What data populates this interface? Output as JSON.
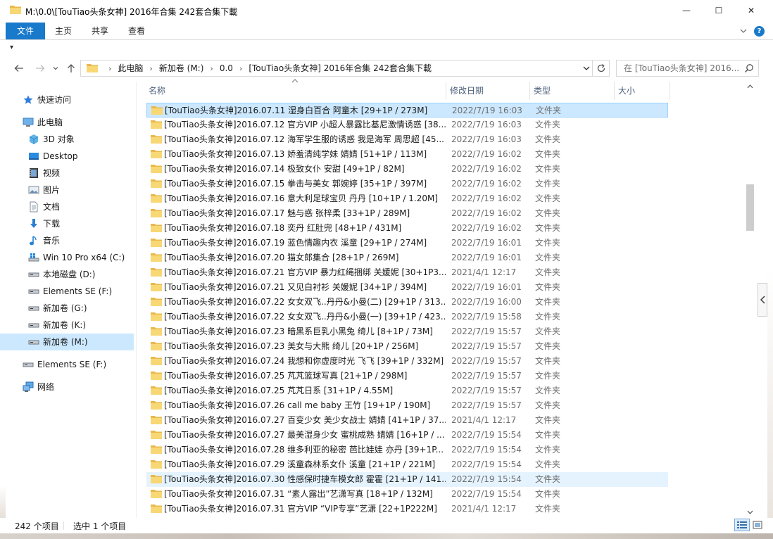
{
  "window": {
    "title": "M:\\0.0\\[TouTiao头条女神] 2016年合集 242套合集下載",
    "min_glyph": "—",
    "max_glyph": "☐",
    "close_glyph": "✕"
  },
  "ribbon": {
    "tabs": [
      "文件",
      "主页",
      "共享",
      "查看"
    ],
    "help_label": "?"
  },
  "qat": {
    "glyph": "▾"
  },
  "address": {
    "crumbs": [
      "此电脑",
      "新加卷 (M:)",
      "0.0",
      "[TouTiao头条女神] 2016年合集 242套合集下載"
    ],
    "separator": "›"
  },
  "search": {
    "placeholder": "在 [TouTiao头条女神] 2016..."
  },
  "navpane": {
    "items": [
      {
        "label": "快速访问",
        "icon": "star-icon"
      },
      {
        "label": "此电脑",
        "icon": "pc-icon"
      },
      {
        "label": "3D 对象",
        "icon": "cube-icon"
      },
      {
        "label": "Desktop",
        "icon": "desktop-icon"
      },
      {
        "label": "视频",
        "icon": "video-icon"
      },
      {
        "label": "图片",
        "icon": "picture-icon"
      },
      {
        "label": "文档",
        "icon": "document-icon"
      },
      {
        "label": "下载",
        "icon": "download-icon"
      },
      {
        "label": "音乐",
        "icon": "music-icon"
      },
      {
        "label": "Win 10 Pro x64 (C:)",
        "icon": "windows-drive-icon"
      },
      {
        "label": "本地磁盘 (D:)",
        "icon": "drive-icon"
      },
      {
        "label": "Elements SE (F:)",
        "icon": "drive-icon"
      },
      {
        "label": "新加卷 (G:)",
        "icon": "drive-icon"
      },
      {
        "label": "新加卷 (K:)",
        "icon": "drive-icon"
      },
      {
        "label": "新加卷 (M:)",
        "icon": "drive-icon"
      },
      {
        "label": "Elements SE (F:)",
        "icon": "drive-icon"
      },
      {
        "label": "网络",
        "icon": "network-icon"
      }
    ]
  },
  "columns": {
    "name": "名称",
    "date": "修改日期",
    "type": "类型",
    "size": "大小"
  },
  "files": [
    {
      "name": "[TouTiao头条女神]2016.07.11 湿身白百合 阿童木 [29+1P / 273M]",
      "date": "2022/7/19 16:03",
      "type": "文件夹"
    },
    {
      "name": "[TouTiao头条女神]2016.07.12 官方VIP 小超人暴露比基尼激情诱惑 [38...",
      "date": "2022/7/19 16:03",
      "type": "文件夹"
    },
    {
      "name": "[TouTiao头条女神]2016.07.12 海军学生服的诱惑 我是海军 周思超 [45...",
      "date": "2022/7/19 16:03",
      "type": "文件夹"
    },
    {
      "name": "[TouTiao头条女神]2016.07.13 娇羞清纯学妹 婧婧 [51+1P / 113M]",
      "date": "2022/7/19 16:02",
      "type": "文件夹"
    },
    {
      "name": "[TouTiao头条女神]2016.07.14 极致女仆 安甜 [49+1P / 82M]",
      "date": "2022/7/19 16:02",
      "type": "文件夹"
    },
    {
      "name": "[TouTiao头条女神]2016.07.15 拳击与美女 郭婉婷 [35+1P / 397M]",
      "date": "2022/7/19 16:02",
      "type": "文件夹"
    },
    {
      "name": "[TouTiao头条女神]2016.07.16 意大利足球宝贝 丹丹 [10+1P / 1.20M]",
      "date": "2022/7/19 16:02",
      "type": "文件夹"
    },
    {
      "name": "[TouTiao头条女神]2016.07.17 魅与惑 张梓柔 [33+1P / 289M]",
      "date": "2022/7/19 16:02",
      "type": "文件夹"
    },
    {
      "name": "[TouTiao头条女神]2016.07.18 奕丹 红肚兜 [48+1P / 431M]",
      "date": "2022/7/19 16:02",
      "type": "文件夹"
    },
    {
      "name": "[TouTiao头条女神]2016.07.19 蓝色情趣内衣 溪童 [29+1P / 274M]",
      "date": "2022/7/19 16:01",
      "type": "文件夹"
    },
    {
      "name": "[TouTiao头条女神]2016.07.20 猫女郎集合 [28+1P / 269M]",
      "date": "2022/7/19 16:01",
      "type": "文件夹"
    },
    {
      "name": "[TouTiao头条女神]2016.07.21 官方VIP  暴力红绳捆绑 关媛妮 [30+1P3...",
      "date": "2021/4/1 12:17",
      "type": "文件夹"
    },
    {
      "name": "[TouTiao头条女神]2016.07.21 又见白衬衫 关媛妮 [34+1P / 394M]",
      "date": "2022/7/19 16:01",
      "type": "文件夹"
    },
    {
      "name": "[TouTiao头条女神]2016.07.22 女女双飞..丹丹&小曼(二) [29+1P / 313...",
      "date": "2022/7/19 16:00",
      "type": "文件夹"
    },
    {
      "name": "[TouTiao头条女神]2016.07.22 女女双飞..丹丹&小曼(一) [39+1P / 423...",
      "date": "2022/7/19 15:58",
      "type": "文件夹"
    },
    {
      "name": "[TouTiao头条女神]2016.07.23 暗黑系巨乳小黑兔 绮儿 [8+1P / 73M]",
      "date": "2022/7/19 15:57",
      "type": "文件夹"
    },
    {
      "name": "[TouTiao头条女神]2016.07.23 美女与大熊 绮儿 [20+1P / 256M]",
      "date": "2022/7/19 15:57",
      "type": "文件夹"
    },
    {
      "name": "[TouTiao头条女神]2016.07.24 我想和你虚度时光 飞飞 [39+1P / 332M]",
      "date": "2022/7/19 15:57",
      "type": "文件夹"
    },
    {
      "name": "[TouTiao头条女神]2016.07.25 芃芃篮球写真 [21+1P / 298M]",
      "date": "2022/7/19 15:57",
      "type": "文件夹"
    },
    {
      "name": "[TouTiao头条女神]2016.07.25 芃芃日系 [31+1P / 4.55M]",
      "date": "2022/7/19 15:57",
      "type": "文件夹"
    },
    {
      "name": "[TouTiao头条女神]2016.07.26 call me baby 王竹 [19+1P / 190M]",
      "date": "2022/7/19 15:57",
      "type": "文件夹"
    },
    {
      "name": "[TouTiao头条女神]2016.07.27 百变少女 美少女战士  婧婧 [41+1P / 37...",
      "date": "2021/4/1 12:17",
      "type": "文件夹"
    },
    {
      "name": "[TouTiao头条女神]2016.07.27 最美湿身少女 蜜桃成熟 婧婧 [16+1P / ...",
      "date": "2022/7/19 15:54",
      "type": "文件夹"
    },
    {
      "name": "[TouTiao头条女神]2016.07.28 维多利亚的秘密 芭比娃娃 亦丹 [39+1P...",
      "date": "2022/7/19 15:54",
      "type": "文件夹"
    },
    {
      "name": "[TouTiao头条女神]2016.07.29 溪童森林系女仆 溪童 [21+1P / 221M]",
      "date": "2022/7/19 15:54",
      "type": "文件夹"
    },
    {
      "name": "[TouTiao头条女神]2016.07.30 性感保时捷车模女郎 霍霍 [21+1P / 141...",
      "date": "2022/7/19 15:54",
      "type": "文件夹"
    },
    {
      "name": "[TouTiao头条女神]2016.07.31 “素人露出”艺潇写真 [18+1P / 132M]",
      "date": "2022/7/19 15:54",
      "type": "文件夹"
    },
    {
      "name": "[TouTiao头条女神]2016.07.31 官方VIP “VIP专享”艺潇 [22+1P222M]",
      "date": "2021/4/1 12:17",
      "type": "文件夹"
    }
  ],
  "status": {
    "count": "242 个项目",
    "selected": "选中 1 个项目"
  },
  "colors": {
    "accent": "#1979ca",
    "selection": "#cce8ff",
    "folder": "#f8d775"
  }
}
